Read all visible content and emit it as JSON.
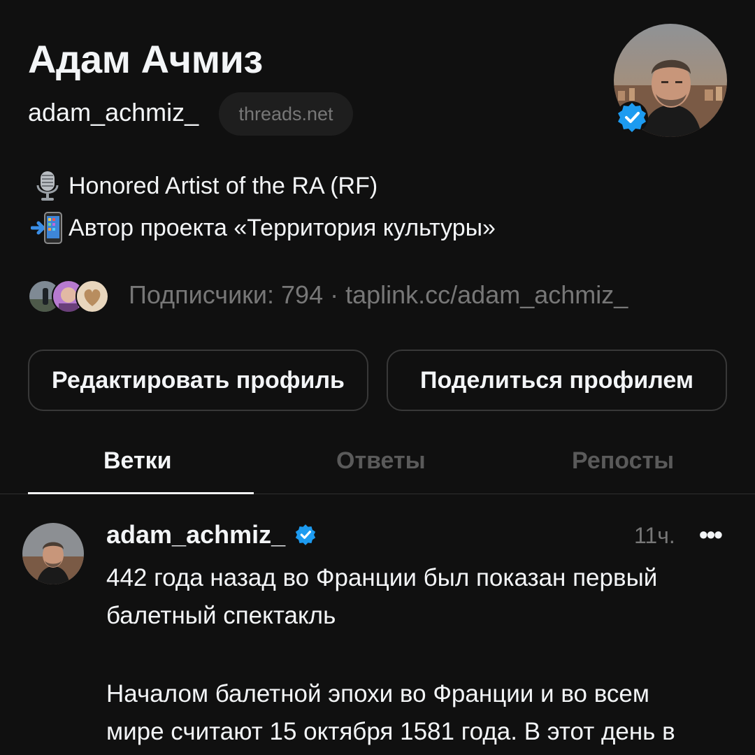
{
  "profile": {
    "name": "Адам Ачмиз",
    "username": "adam_achmiz_",
    "domain_badge": "threads.net",
    "bio": [
      {
        "icon": "microphone-icon",
        "text": "Honored Artist of the RA (RF)"
      },
      {
        "icon": "mobile-arrow-icon",
        "text": "Автор проекта «Территория культуры»"
      }
    ],
    "followers_text": "Подписчики: 794 · taplink.cc/adam_achmiz_"
  },
  "buttons": {
    "edit": "Редактировать профиль",
    "share": "Поделиться профилем"
  },
  "tabs": [
    {
      "label": "Ветки",
      "active": true
    },
    {
      "label": "Ответы",
      "active": false
    },
    {
      "label": "Репосты",
      "active": false
    }
  ],
  "post": {
    "author": "adam_achmiz_",
    "time": "11ч.",
    "more": "•••",
    "paragraphs": [
      [
        "442 года назад во Франции был показан первый",
        "балетный спектакль"
      ],
      [
        "Началом балетной эпохи во Франции и во всем",
        "мире считают 15 октября 1581 года. В этот день в"
      ]
    ]
  },
  "colors": {
    "background": "#101010",
    "text_primary": "#f3f5f7",
    "text_secondary": "#777777",
    "verified": "#1d9bf0",
    "border": "#383838"
  }
}
